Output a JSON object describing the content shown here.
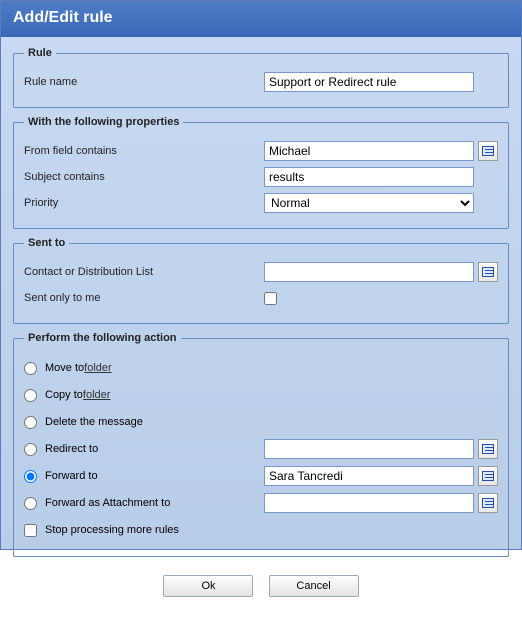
{
  "title": "Add/Edit rule",
  "rule": {
    "legend": "Rule",
    "name_label": "Rule name",
    "name_value": "Support or Redirect rule"
  },
  "props": {
    "legend": "With the following properties",
    "from_label": "From field contains",
    "from_value": "Michael",
    "subject_label": "Subject contains",
    "subject_value": "results",
    "priority_label": "Priority",
    "priority_value": "Normal"
  },
  "sent": {
    "legend": "Sent to",
    "contact_label": "Contact or Distribution List",
    "contact_value": "",
    "only_me_label": "Sent only to me"
  },
  "action": {
    "legend": "Perform the following action",
    "move_prefix": "Move to ",
    "move_link": "folder",
    "copy_prefix": "Copy to ",
    "copy_link": "folder",
    "delete_label": "Delete the message",
    "redirect_label": "Redirect to",
    "redirect_value": "",
    "forward_label": "Forward to",
    "forward_value": "Sara Tancredi",
    "forward_attach_label": "Forward as Attachment to",
    "forward_attach_value": "",
    "stop_label": "Stop processing more rules"
  },
  "buttons": {
    "ok": "Ok",
    "cancel": "Cancel"
  }
}
